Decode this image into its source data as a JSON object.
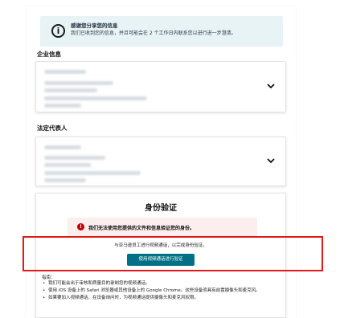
{
  "banner": {
    "icon": "info-icon",
    "title": "感谢您分享您的信息",
    "text": "我们已收到您的信息，并且可能会在 2 个工作日内联系您以进行进一步澄清。"
  },
  "sections": {
    "company": {
      "label": "企业信息"
    },
    "legal_rep": {
      "label": "法定代表人"
    }
  },
  "verification": {
    "title": "身份验证",
    "error_icon": "alert-icon",
    "error_text": "我们无法使用您提供的文件和信息验证您的身份。",
    "video_desc": "与亚马逊员工进行视频通话，以完成身份验证。",
    "video_button": "使用视频通话进行验证"
  },
  "guide": {
    "title": "指南：",
    "items": [
      "我们可能会出于审核和质量目的录制您的视频通话。",
      "使用 iOS 设备上的 Safari 浏览器或其他设备上的 Google Chrome。这些设备须具有前置摄像头和麦克风。",
      "如果要加入视频通话，在设备询问时，为视频通话提供摄像头和麦克风权限。"
    ]
  },
  "colors": {
    "banner_bg": "#e7f3f4",
    "error_bg": "#fdeeee",
    "error_icon": "#c40000",
    "button": "#007185",
    "highlight": "#e01919"
  }
}
